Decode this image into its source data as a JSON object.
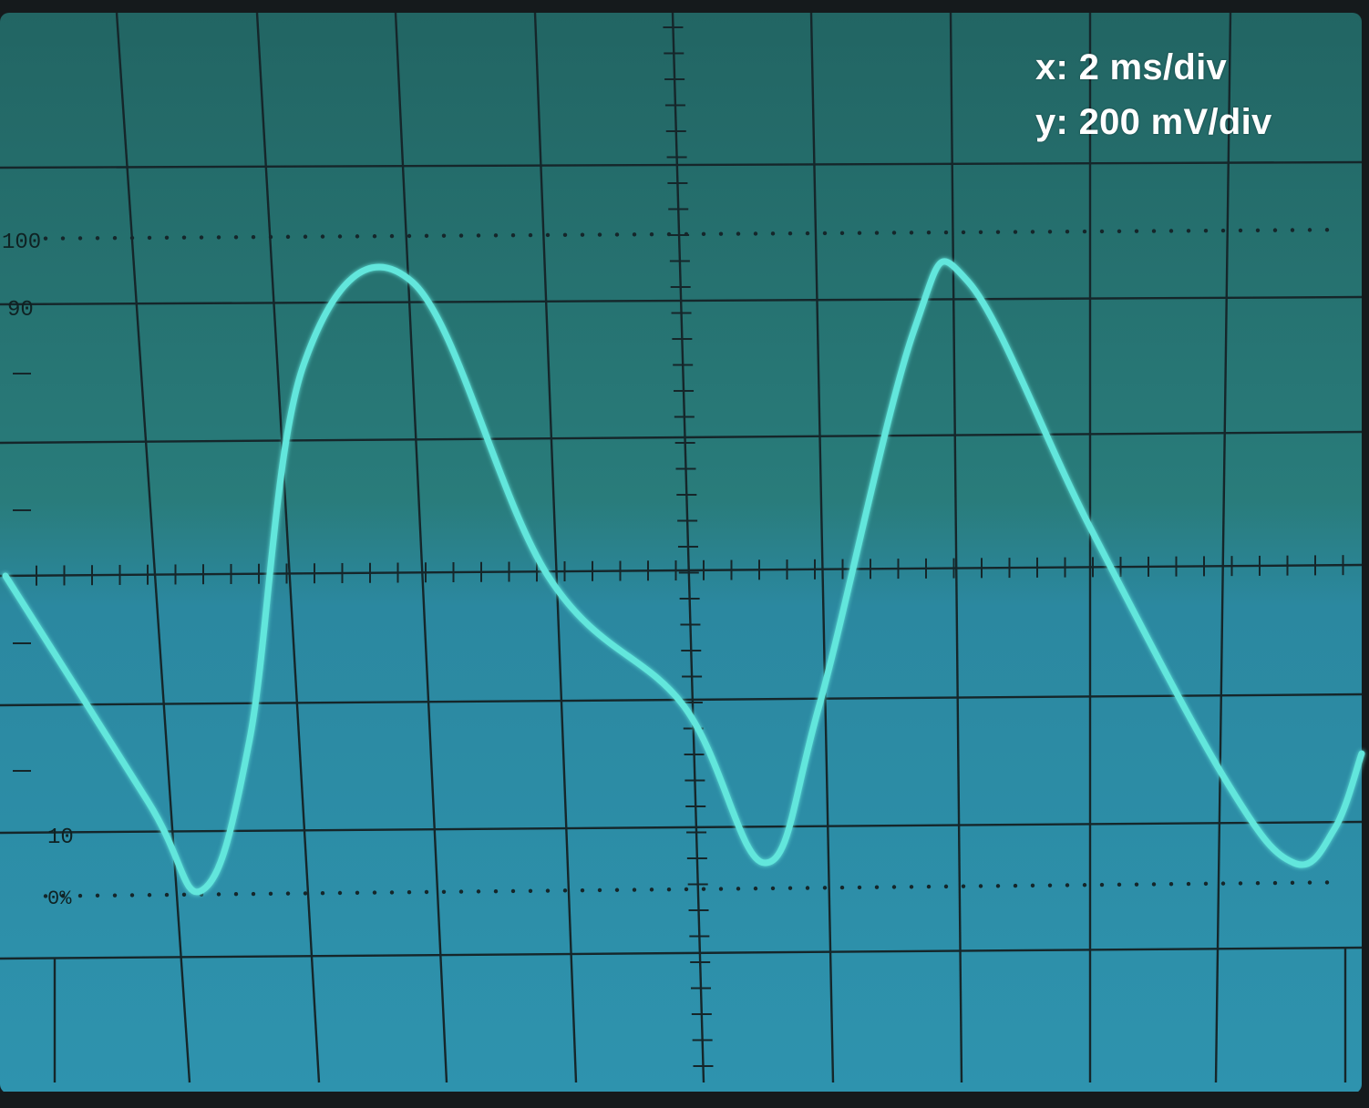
{
  "scope": {
    "scale_x": "x: 2 ms/div",
    "scale_y": "y: 200 mV/div",
    "graticule_labels": {
      "l100": "100",
      "l90": "90",
      "l10": "10",
      "l0": "0%"
    }
  },
  "trace": {
    "type": "line",
    "waveform": "asymmetric triangle / distorted sine",
    "x_unit": "ms",
    "y_unit": "mV",
    "x_range_ms": [
      0,
      20
    ],
    "y_range_mV": [
      -800,
      800
    ],
    "x_ms": [
      0.0,
      2.1,
      2.9,
      3.6,
      4.4,
      6.0,
      8.0,
      10.0,
      11.2,
      12.0,
      13.4,
      14.2,
      16.0,
      18.0,
      19.0,
      19.6,
      20.0
    ],
    "y_mV": [
      0,
      -330,
      -460,
      -240,
      310,
      430,
      0,
      -190,
      -420,
      -190,
      360,
      430,
      70,
      -300,
      -420,
      -370,
      -260
    ]
  },
  "colors": {
    "screen_top": "#27706e",
    "screen_bottom": "#2c90a8",
    "grid": "#15262a",
    "trace": "#62e6dc",
    "bezel": "#151a1c"
  }
}
